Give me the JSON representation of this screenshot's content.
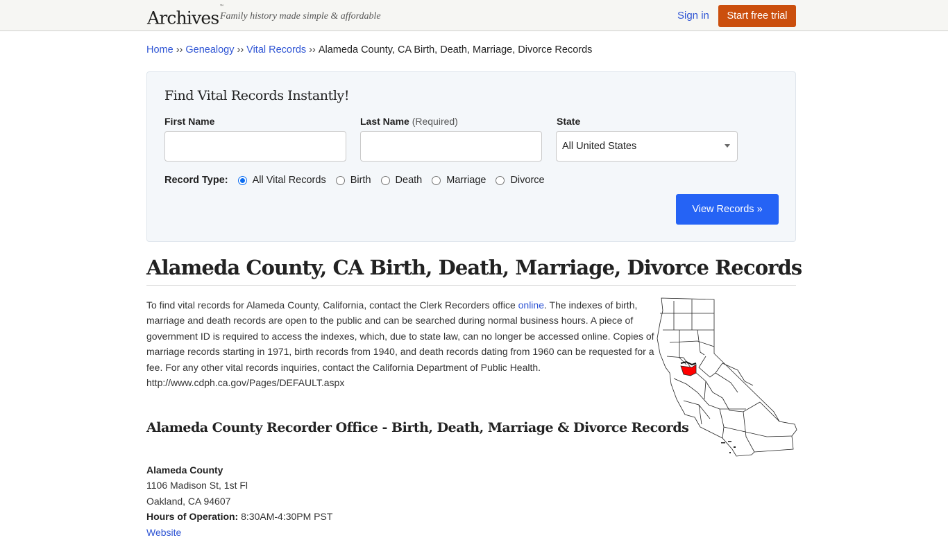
{
  "header": {
    "logo": "Archives",
    "logo_mark": "™",
    "tagline": "Family history made simple & affordable",
    "sign_in": "Sign in",
    "start_trial": "Start free trial"
  },
  "breadcrumb": {
    "separator": "››",
    "items": [
      {
        "label": "Home"
      },
      {
        "label": "Genealogy"
      },
      {
        "label": "Vital Records"
      }
    ],
    "current": "Alameda County, CA Birth, Death, Marriage, Divorce Records"
  },
  "search": {
    "title": "Find Vital Records Instantly!",
    "first_name": {
      "label": "First Name",
      "value": "",
      "placeholder": ""
    },
    "last_name": {
      "label": "Last Name",
      "note": "(Required)",
      "value": "",
      "placeholder": ""
    },
    "state": {
      "label": "State",
      "selected": "All United States"
    },
    "record_type": {
      "label": "Record Type:",
      "options": [
        {
          "label": "All Vital Records",
          "checked": true
        },
        {
          "label": "Birth",
          "checked": false
        },
        {
          "label": "Death",
          "checked": false
        },
        {
          "label": "Marriage",
          "checked": false
        },
        {
          "label": "Divorce",
          "checked": false
        }
      ]
    },
    "submit": "View Records »"
  },
  "page": {
    "title": "Alameda County, CA Birth, Death, Marriage, Divorce Records",
    "intro_before_link": "To find vital records for Alameda County, California, contact the Clerk Recorders office ",
    "intro_link": "online",
    "intro_after_link": ". The indexes of birth, marriage and death records are open to the public and can be searched during normal business hours. A piece of government ID is required to access the indexes, which, due to state law, can no longer be accessed online. Copies of marriage records starting in 1971, birth records from 1940, and death records dating from 1960 can be requested for a fee. For any other vital records inquiries, contact the California Department of Public Health.",
    "intro_url": "http://www.cdph.ca.gov/Pages/DEFAULT.aspx",
    "map_alt": "California county map with Alameda County highlighted",
    "map_highlight_color": "#ff0000"
  },
  "office": {
    "section_title": "Alameda County Recorder Office - Birth, Death, Marriage & Divorce Records",
    "name": "Alameda County",
    "address_line1": "1106 Madison St, 1st Fl",
    "address_line2": "Oakland, CA 94607",
    "hours_label": "Hours of Operation:",
    "hours_value": "8:30AM-4:30PM PST",
    "website_label": "Website"
  },
  "colors": {
    "link": "#2f55d4",
    "trial_button": "#cb4f0d",
    "view_button": "#2563f5",
    "search_bg": "#f4f7fa",
    "header_bg": "#f6f6f3"
  }
}
